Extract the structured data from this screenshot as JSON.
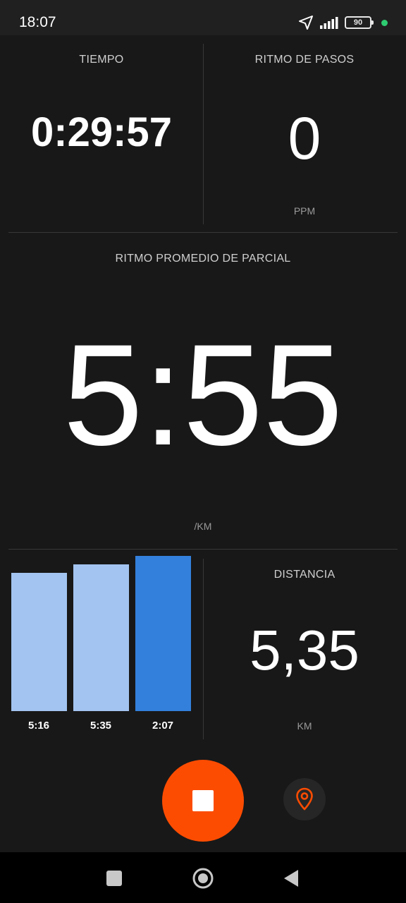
{
  "status": {
    "time": "18:07",
    "battery": "90",
    "icons": [
      "location-arrow-icon",
      "signal-icon",
      "battery-icon",
      "privacy-dot-icon"
    ]
  },
  "tiempo": {
    "label": "TIEMPO",
    "value": "0:29:57"
  },
  "ritmo_pasos": {
    "label": "RITMO DE PASOS",
    "value": "0",
    "unit": "PPM"
  },
  "ritmo_parcial": {
    "label": "RITMO PROMEDIO DE PARCIAL",
    "value": "5:55",
    "unit": "/KM"
  },
  "distancia": {
    "label": "DISTANCIA",
    "value": "5,35",
    "unit": "KM"
  },
  "chart_data": {
    "type": "bar",
    "categories": [
      "5:16",
      "5:35",
      "2:07"
    ],
    "values": [
      196,
      208,
      220
    ],
    "colors": [
      "#a3c4f0",
      "#a3c4f0",
      "#3380dc"
    ]
  },
  "controls": {
    "stop_icon": "stop-icon",
    "map_icon": "map-pin-icon",
    "accent": "#fc4c02"
  },
  "nav": {
    "icons": [
      "recents-square-icon",
      "home-circle-icon",
      "back-triangle-icon"
    ]
  }
}
